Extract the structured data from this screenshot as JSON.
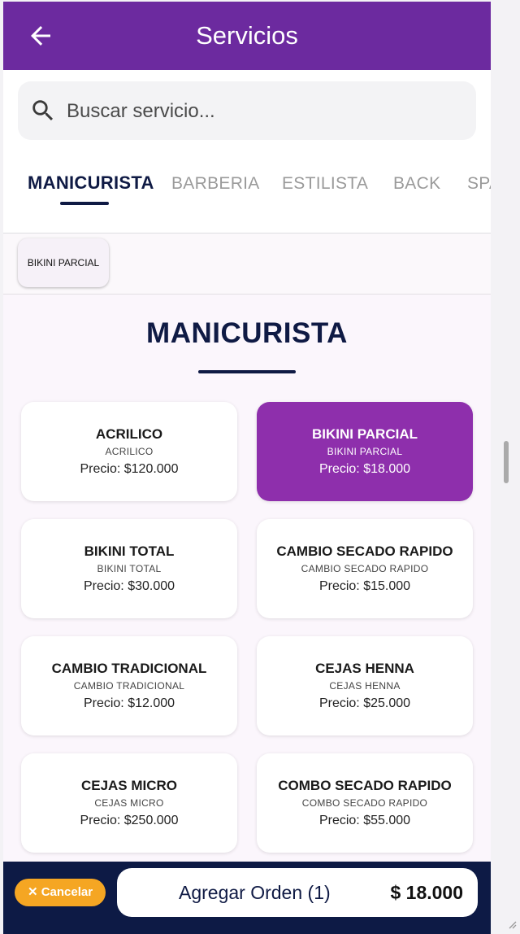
{
  "appbar": {
    "title": "Servicios"
  },
  "search": {
    "placeholder": "Buscar servicio..."
  },
  "tabs": [
    "MANICURISTA",
    "BARBERIA",
    "ESTILISTA",
    "BACK",
    "SPA"
  ],
  "chip": {
    "label": "BIKINI PARCIAL"
  },
  "section": {
    "title": "MANICURISTA"
  },
  "services": [
    {
      "name": "ACRILICO",
      "sub": "ACRILICO",
      "price": "Precio: $120.000"
    },
    {
      "name": "BIKINI PARCIAL",
      "sub": "BIKINI PARCIAL",
      "price": "Precio: $18.000"
    },
    {
      "name": "BIKINI TOTAL",
      "sub": "BIKINI TOTAL",
      "price": "Precio: $30.000"
    },
    {
      "name": "CAMBIO SECADO RAPIDO",
      "sub": "CAMBIO SECADO RAPIDO",
      "price": "Precio: $15.000"
    },
    {
      "name": "CAMBIO TRADICIONAL",
      "sub": "CAMBIO TRADICIONAL",
      "price": "Precio: $12.000"
    },
    {
      "name": "CEJAS HENNA",
      "sub": "CEJAS HENNA",
      "price": "Precio: $25.000"
    },
    {
      "name": "CEJAS MICRO",
      "sub": "CEJAS MICRO",
      "price": "Precio: $250.000"
    },
    {
      "name": "COMBO SECADO RAPIDO",
      "sub": "COMBO SECADO RAPIDO",
      "price": "Precio: $55.000"
    }
  ],
  "bottom": {
    "cancel_label": "Cancelar",
    "order_label": "Agregar Orden (1)",
    "total": "$ 18.000"
  },
  "colors": {
    "primary": "#6c2a9f",
    "selected": "#8e2fac",
    "navy": "#0f1a44",
    "accent": "#f5a623"
  }
}
